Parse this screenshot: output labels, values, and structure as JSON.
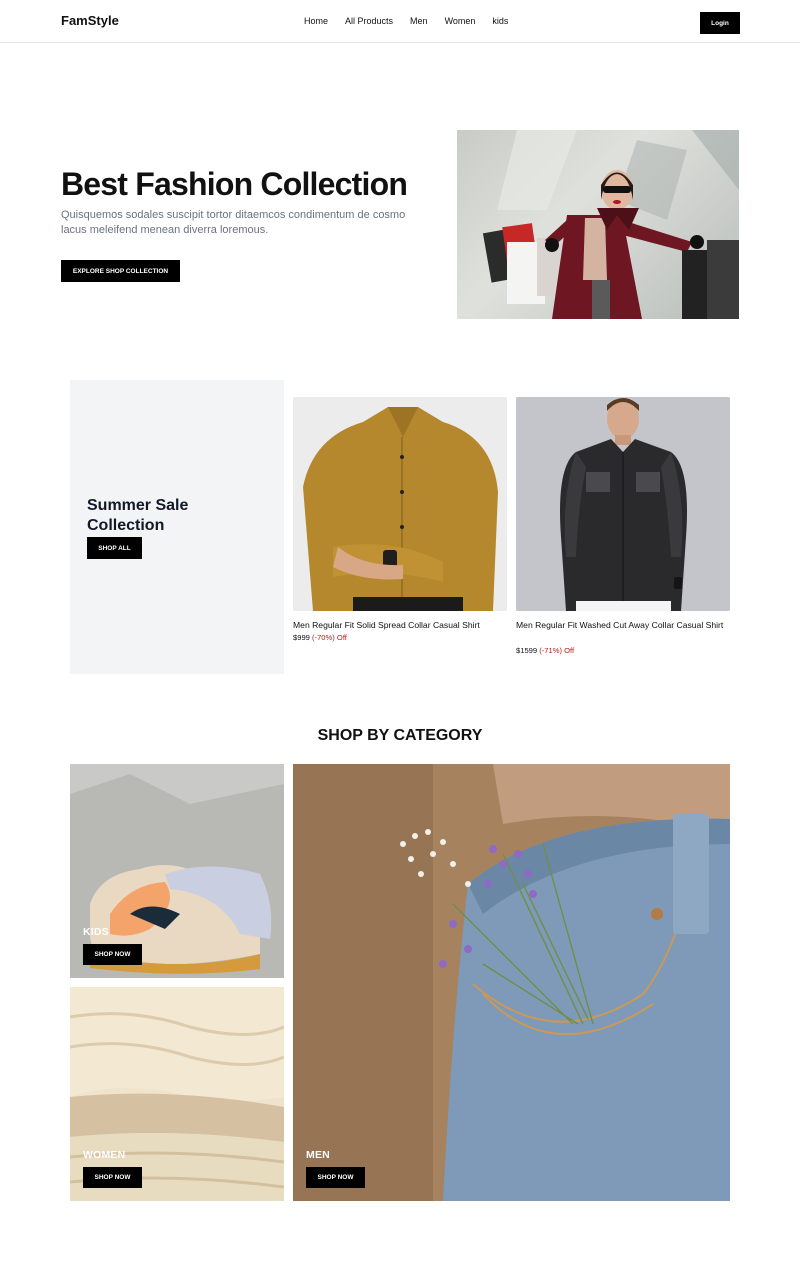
{
  "header": {
    "logo": "FamStyle",
    "nav": [
      "Home",
      "All Products",
      "Men",
      "Women",
      "kids"
    ],
    "login_label": "Login"
  },
  "hero": {
    "title": "Best Fashion Collection",
    "description": "Quisquemos sodales suscipit tortor ditaemcos condimentum de cosmo lacus meleifend menean diverra loremous.",
    "button_label": "EXPLORE SHOP COLLECTION"
  },
  "sale": {
    "title": "Summer Sale Collection",
    "button_label": "SHOP ALL",
    "products": [
      {
        "name": "Men Regular Fit Solid Spread Collar Casual Shirt",
        "price": "$999",
        "discount": "(-70%) Off"
      },
      {
        "name": "Men Regular Fit Washed Cut Away Collar Casual Shirt",
        "price": "$1599",
        "discount": "(-71%) Off"
      }
    ]
  },
  "category": {
    "heading": "SHOP BY CATEGORY",
    "tiles": [
      {
        "label": "KIDS",
        "button": "SHOP NOW"
      },
      {
        "label": "WOMEN",
        "button": "SHOP NOW"
      },
      {
        "label": "MEN",
        "button": "SHOP NOW"
      }
    ]
  },
  "colors": {
    "accent": "#000000",
    "discount": "#b91c1c",
    "muted": "#6b7280",
    "panel": "#f3f4f6"
  }
}
